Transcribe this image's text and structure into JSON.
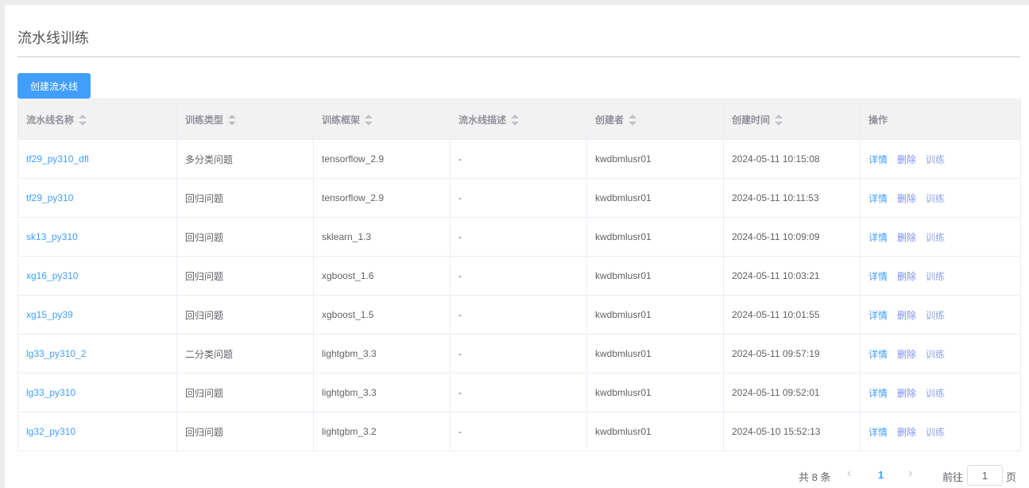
{
  "page": {
    "title": "流水线训练",
    "create_button": "创建流水线"
  },
  "columns": [
    "流水线名称",
    "训练类型",
    "训练框架",
    "流水线描述",
    "创建者",
    "创建时间",
    "操作"
  ],
  "actions": {
    "detail": "详情",
    "delete": "删除",
    "train": "训练"
  },
  "colors": {
    "accent": "#409eff",
    "delete": "#7f8ff5",
    "train": "#8fa6e3"
  },
  "rows": [
    {
      "name": "tf29_py310_dfl",
      "type": "多分类问题",
      "framework": "tensorflow_2.9",
      "desc": "-",
      "creator": "kwdbmlusr01",
      "time": "2024-05-11 10:15:08"
    },
    {
      "name": "tf29_py310",
      "type": "回归问题",
      "framework": "tensorflow_2.9",
      "desc": "-",
      "creator": "kwdbmlusr01",
      "time": "2024-05-11 10:11:53"
    },
    {
      "name": "sk13_py310",
      "type": "回归问题",
      "framework": "sklearn_1.3",
      "desc": "-",
      "creator": "kwdbmlusr01",
      "time": "2024-05-11 10:09:09"
    },
    {
      "name": "xg16_py310",
      "type": "回归问题",
      "framework": "xgboost_1.6",
      "desc": "-",
      "creator": "kwdbmlusr01",
      "time": "2024-05-11 10:03:21"
    },
    {
      "name": "xg15_py39",
      "type": "回归问题",
      "framework": "xgboost_1.5",
      "desc": "-",
      "creator": "kwdbmlusr01",
      "time": "2024-05-11 10:01:55"
    },
    {
      "name": "lg33_py310_2",
      "type": "二分类问题",
      "framework": "lightgbm_3.3",
      "desc": "-",
      "creator": "kwdbmlusr01",
      "time": "2024-05-11 09:57:19"
    },
    {
      "name": "lg33_py310",
      "type": "回归问题",
      "framework": "lightgbm_3.3",
      "desc": "-",
      "creator": "kwdbmlusr01",
      "time": "2024-05-11 09:52:01"
    },
    {
      "name": "lg32_py310",
      "type": "回归问题",
      "framework": "lightgbm_3.2",
      "desc": "-",
      "creator": "kwdbmlusr01",
      "time": "2024-05-10 15:52:13"
    }
  ],
  "pagination": {
    "total": "共 8 条",
    "prev": "‹",
    "current": "1",
    "next": "›",
    "goto_label": "前往",
    "goto_value": "1",
    "page_suffix": "页"
  }
}
